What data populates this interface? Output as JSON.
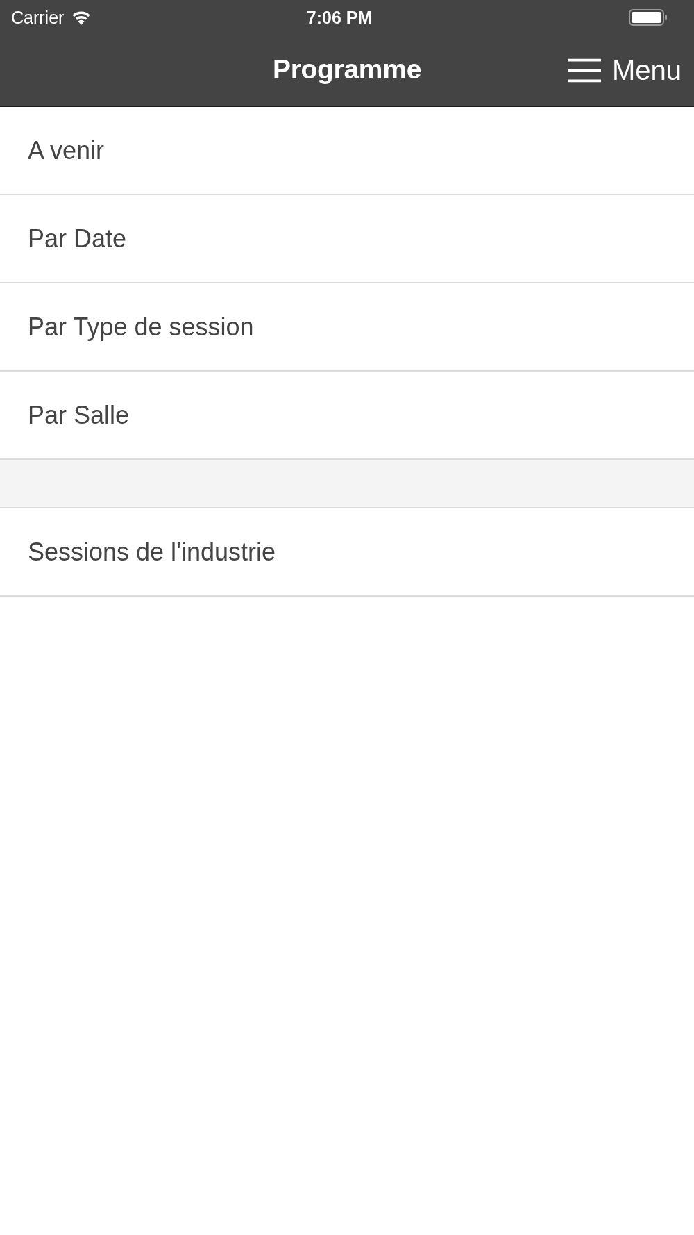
{
  "status_bar": {
    "carrier": "Carrier",
    "time": "7:06 PM"
  },
  "nav_bar": {
    "title": "Programme",
    "menu_button": {
      "label": "Menu"
    }
  },
  "list": {
    "items": [
      {
        "kind": "row",
        "label": "A venir"
      },
      {
        "kind": "row",
        "label": "Par Date"
      },
      {
        "kind": "row",
        "label": "Par Type de session"
      },
      {
        "kind": "row",
        "label": "Par Salle"
      },
      {
        "kind": "spacer"
      },
      {
        "kind": "row",
        "label": "Sessions de l'industrie"
      }
    ]
  }
}
